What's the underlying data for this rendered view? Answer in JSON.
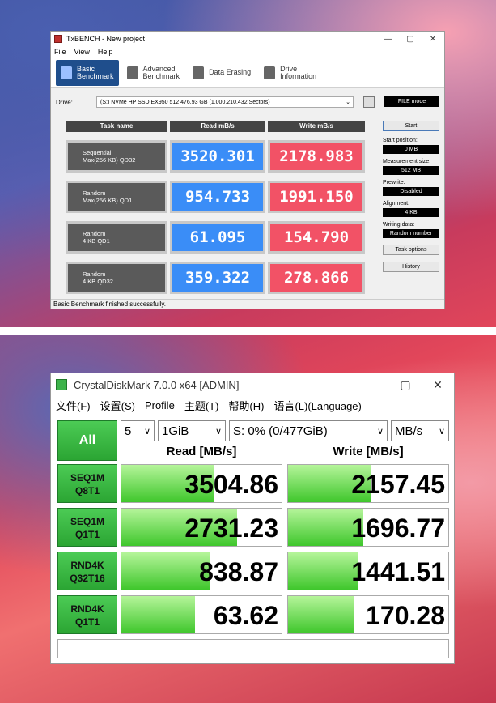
{
  "txbench": {
    "title": "TxBENCH - New project",
    "controls": [
      "—",
      "▢",
      "✕"
    ],
    "menu": [
      "File",
      "View",
      "Help"
    ],
    "tabs": [
      {
        "label": "Basic\nBenchmark",
        "active": true
      },
      {
        "label": "Advanced\nBenchmark",
        "active": false
      },
      {
        "label": "Data Erasing",
        "active": false
      },
      {
        "label": "Drive\nInformation",
        "active": false
      }
    ],
    "drive_label": "Drive:",
    "drive_value": "(S:) NVMe HP SSD EX950 512   476.93 GB (1,000,210,432 Sectors)",
    "file_mode": "FILE mode",
    "headers": {
      "task": "Task name",
      "read": "Read mB/s",
      "write": "Write mB/s"
    },
    "rows": [
      {
        "task1": "Sequential",
        "task2": "Max(256 KB) QD32",
        "read": "3520.301",
        "write": "2178.983"
      },
      {
        "task1": "Random",
        "task2": "Max(256 KB) QD1",
        "read": "954.733",
        "write": "1991.150"
      },
      {
        "task1": "Random",
        "task2": "4 KB QD1",
        "read": "61.095",
        "write": "154.790"
      },
      {
        "task1": "Random",
        "task2": "4 KB QD32",
        "read": "359.322",
        "write": "278.866"
      }
    ],
    "start_button": "Start",
    "start_pos_label": "Start position:",
    "start_pos_value": "0 MB",
    "meas_label": "Measurement size:",
    "meas_value": "512 MB",
    "prewrite_label": "Prewrite:",
    "prewrite_value": "Disabled",
    "align_label": "Alignment:",
    "align_value": "4 KB",
    "writing_label": "Writing data:",
    "writing_value": "Random number",
    "task_options": "Task options",
    "history": "History",
    "status": "Basic Benchmark finished successfully."
  },
  "cdm": {
    "title": "CrystalDiskMark 7.0.0 x64 [ADMIN]",
    "controls": [
      "—",
      "▢",
      "✕"
    ],
    "menu": [
      "文件(F)",
      "设置(S)",
      "Profile",
      "主题(T)",
      "帮助(H)",
      "语言(L)(Language)"
    ],
    "all_button": "All",
    "count": "5",
    "size": "1GiB",
    "drive": "S: 0% (0/477GiB)",
    "unit": "MB/s",
    "read_header": "Read [MB/s]",
    "write_header": "Write [MB/s]",
    "rows": [
      {
        "l1": "SEQ1M",
        "l2": "Q8T1",
        "read": "3504.86",
        "write": "2157.45",
        "read_fill": 0.58,
        "write_fill": 0.52
      },
      {
        "l1": "SEQ1M",
        "l2": "Q1T1",
        "read": "2731.23",
        "write": "1696.77",
        "read_fill": 0.72,
        "write_fill": 0.47
      },
      {
        "l1": "RND4K",
        "l2": "Q32T16",
        "read": "838.87",
        "write": "1441.51",
        "read_fill": 0.55,
        "write_fill": 0.44
      },
      {
        "l1": "RND4K",
        "l2": "Q1T1",
        "read": "63.62",
        "write": "170.28",
        "read_fill": 0.46,
        "write_fill": 0.41
      }
    ],
    "comment": ""
  }
}
